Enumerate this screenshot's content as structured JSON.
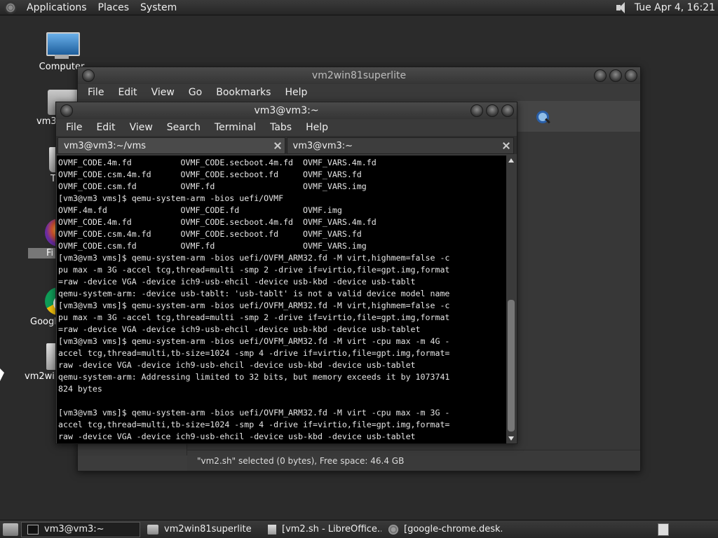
{
  "top_panel": {
    "menus": [
      "Applications",
      "Places",
      "System"
    ],
    "clock": "Tue Apr  4, 16:21"
  },
  "desktop_icons": [
    "Computer",
    "vm3'",
    "T",
    "Fi",
    "Google",
    "vm2win"
  ],
  "file_manager": {
    "title": "vm2win81superlite",
    "menus": [
      "File",
      "Edit",
      "View",
      "Go",
      "Bookmarks",
      "Help"
    ],
    "status": "\"vm2.sh\" selected (0 bytes), Free space: 46.4 GB"
  },
  "terminal": {
    "title": "vm3@vm3:~",
    "menus": [
      "File",
      "Edit",
      "View",
      "Search",
      "Terminal",
      "Tabs",
      "Help"
    ],
    "tabs": [
      {
        "label": "vm3@vm3:~/vms"
      },
      {
        "label": "vm3@vm3:~"
      }
    ],
    "lines": [
      "OVMF_CODE.4m.fd          OVMF_CODE.secboot.4m.fd  OVMF_VARS.4m.fd",
      "OVMF_CODE.csm.4m.fd      OVMF_CODE.secboot.fd     OVMF_VARS.fd",
      "OVMF_CODE.csm.fd         OVMF.fd                  OVMF_VARS.img",
      "[vm3@vm3 vms]$ qemu-system-arm -bios uefi/OVMF",
      "OVMF.4m.fd               OVMF_CODE.fd             OVMF.img",
      "OVMF_CODE.4m.fd          OVMF_CODE.secboot.4m.fd  OVMF_VARS.4m.fd",
      "OVMF_CODE.csm.4m.fd      OVMF_CODE.secboot.fd     OVMF_VARS.fd",
      "OVMF_CODE.csm.fd         OVMF.fd                  OVMF_VARS.img",
      "[vm3@vm3 vms]$ qemu-system-arm -bios uefi/OVFM_ARM32.fd -M virt,highmem=false -c",
      "pu max -m 3G -accel tcg,thread=multi -smp 2 -drive if=virtio,file=gpt.img,format",
      "=raw -device VGA -device ich9-usb-ehcil -device usb-kbd -device usb-tablt",
      "qemu-system-arm: -device usb-tablt: 'usb-tablt' is not a valid device model name",
      "[vm3@vm3 vms]$ qemu-system-arm -bios uefi/OVFM_ARM32.fd -M virt,highmem=false -c",
      "pu max -m 3G -accel tcg,thread=multi -smp 2 -drive if=virtio,file=gpt.img,format",
      "=raw -device VGA -device ich9-usb-ehcil -device usb-kbd -device usb-tablet",
      "[vm3@vm3 vms]$ qemu-system-arm -bios uefi/OVFM_ARM32.fd -M virt -cpu max -m 4G -",
      "accel tcg,thread=multi,tb-size=1024 -smp 4 -drive if=virtio,file=gpt.img,format=",
      "raw -device VGA -device ich9-usb-ehcil -device usb-kbd -device usb-tablet",
      "qemu-system-arm: Addressing limited to 32 bits, but memory exceeds it by 1073741",
      "824 bytes",
      "",
      "[vm3@vm3 vms]$ qemu-system-arm -bios uefi/OVFM_ARM32.fd -M virt -cpu max -m 3G -",
      "accel tcg,thread=multi,tb-size=1024 -smp 4 -drive if=virtio,file=gpt.img,format=",
      "raw -device VGA -device ich9-usb-ehcil -device usb-kbd -device usb-tablet"
    ]
  },
  "taskbar": {
    "tasks": [
      {
        "label": "vm3@vm3:~"
      },
      {
        "label": "vm2win81superlite"
      },
      {
        "label": "[vm2.sh - LibreOffice..."
      },
      {
        "label": "[google-chrome.desk..."
      }
    ]
  }
}
